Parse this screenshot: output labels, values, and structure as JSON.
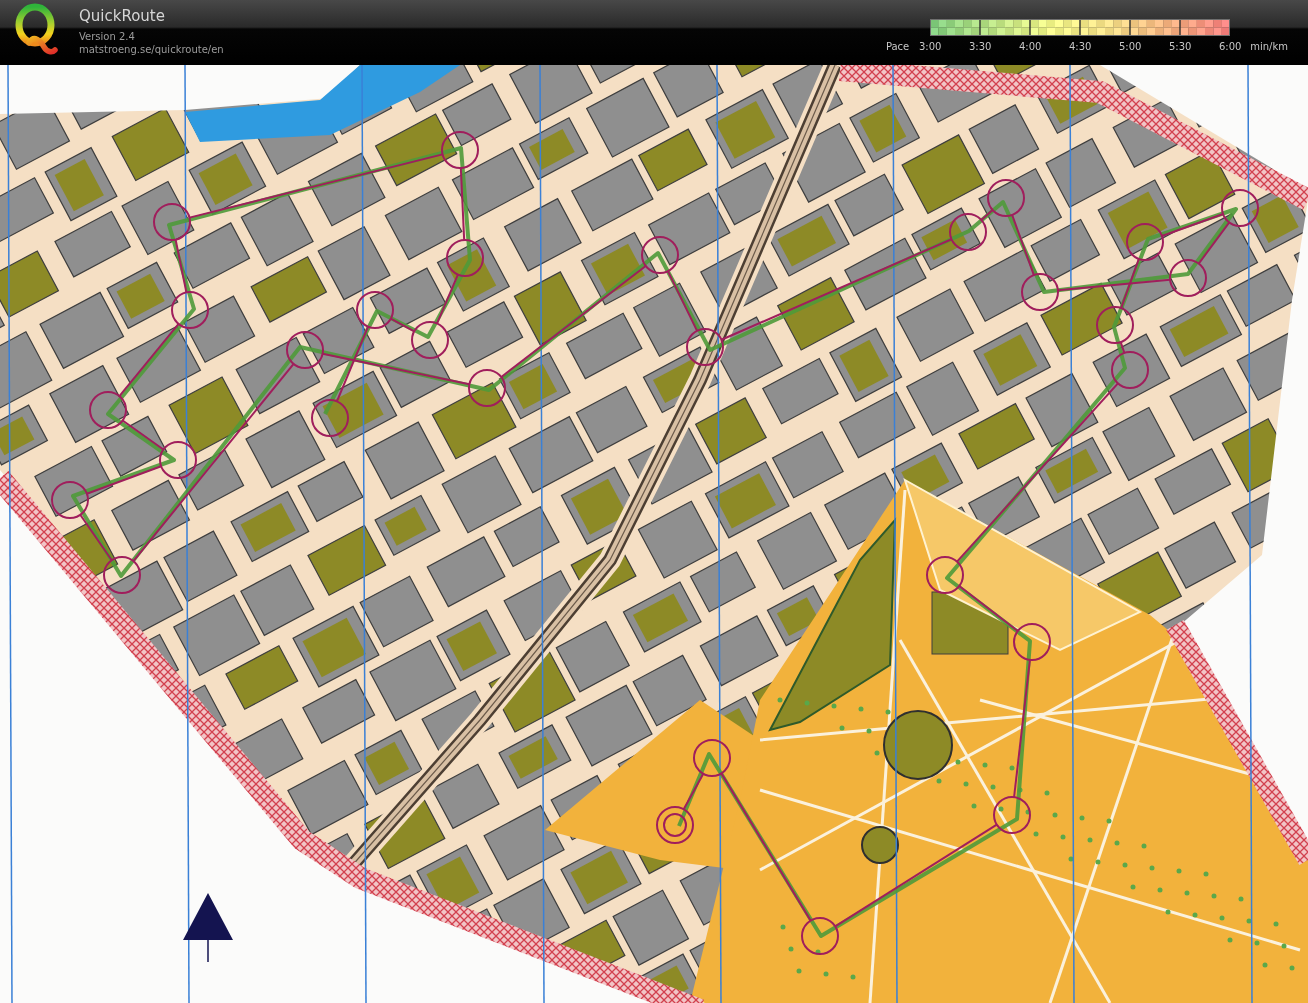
{
  "header": {
    "app_name": "QuickRoute",
    "version": "Version 2.4",
    "url": "matstroeng.se/quickroute/en"
  },
  "pace_scale": {
    "label": "Pace",
    "ticks": [
      "3:00",
      "3:30",
      "4:00",
      "4:30",
      "5:00",
      "5:30",
      "6:00"
    ],
    "unit": "min/km"
  }
}
